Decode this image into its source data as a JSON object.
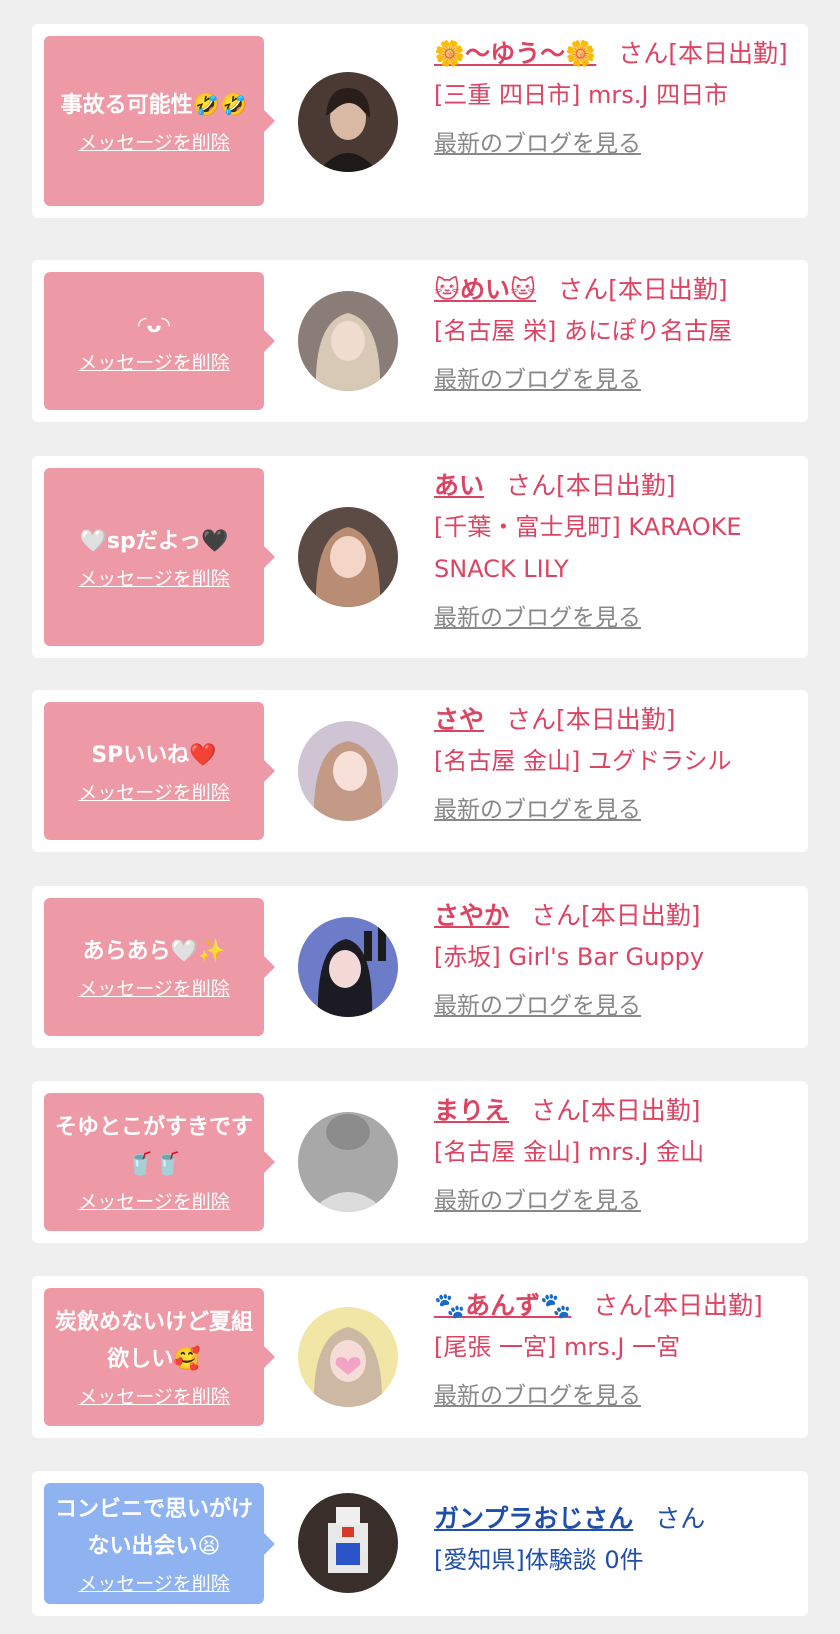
{
  "delete_label": "メッセージを削除",
  "blog_label": "最新のブログを見る",
  "san_suffix": "さん[本日出勤]",
  "cards": [
    {
      "message": "事故る可能性🤣🤣",
      "name": "🌼〜ゆう〜🌼",
      "shop": "[三重 四日市] mrs.J 四日市"
    },
    {
      "message": "◜ᴗ◝",
      "name": "🐱めい🐱",
      "shop": "[名古屋 栄] あにぽり名古屋"
    },
    {
      "message": "🤍spだよっ🖤",
      "name": "あい",
      "shop": "[千葉・富士見町] KARAOKE SNACK LILY"
    },
    {
      "message": "SPいいね❤️",
      "name": "さや",
      "shop": "[名古屋 金山] ユグドラシル"
    },
    {
      "message": "あらあら🤍✨",
      "name": "さやか",
      "shop": "[赤坂] Girl's Bar Guppy"
    },
    {
      "message": "そゆとこがすきです🥤🥤",
      "name": "まりえ",
      "shop": "[名古屋 金山] mrs.J 金山"
    },
    {
      "message": "炭飲めないけど夏組欲しい🥰",
      "name": "🐾あんず🐾",
      "shop": "[尾張 一宮] mrs.J 一宮"
    },
    {
      "message": "コンビニで思いがけない出会い😫",
      "name": "ガンプラおじさん",
      "suffix": "さん",
      "shop": "[愛知県]体験談 0件"
    }
  ],
  "colors": {
    "page_bg": "#efefef",
    "pink_bubble": "#ee9aa6",
    "blue_bubble": "#8fb3f1",
    "girl_text": "#dc4463",
    "guy_text": "#1f4fa8",
    "blog_link": "#888888"
  }
}
